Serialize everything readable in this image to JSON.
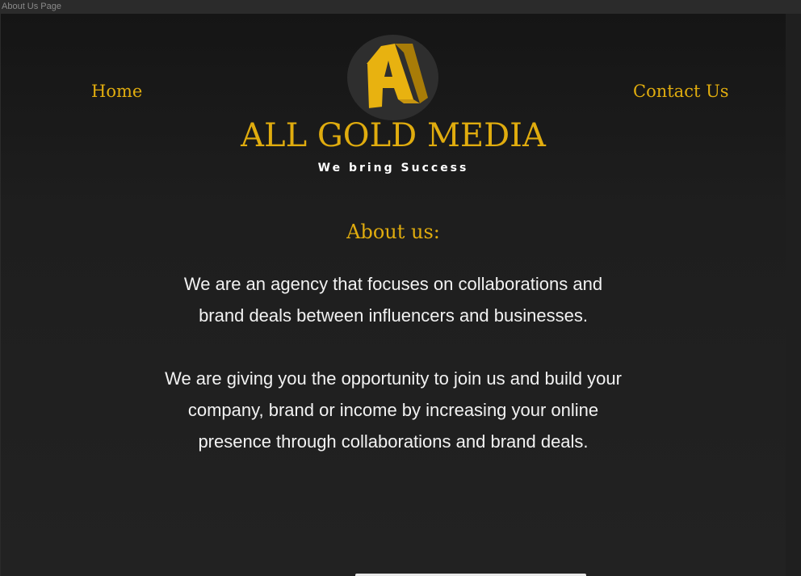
{
  "frame": {
    "label": "About Us Page"
  },
  "nav": {
    "home_label": "Home",
    "contact_label": "Contact Us"
  },
  "brand": {
    "name": "ALL GOLD MEDIA",
    "tagline": "We bring Success",
    "logo_icon": "gold-letter-a-logo-icon"
  },
  "about": {
    "heading": "About us:",
    "paragraph_1": "We are an agency that focuses on collaborations and brand deals between influencers and businesses.",
    "paragraph_2": "We are giving you the opportunity to join us and build your company, brand or income by increasing your online presence through collaborations and brand deals."
  },
  "colors": {
    "accent_gold": "#e0ac0e",
    "background": "#1e1e1e",
    "text": "#f2f2f2"
  }
}
